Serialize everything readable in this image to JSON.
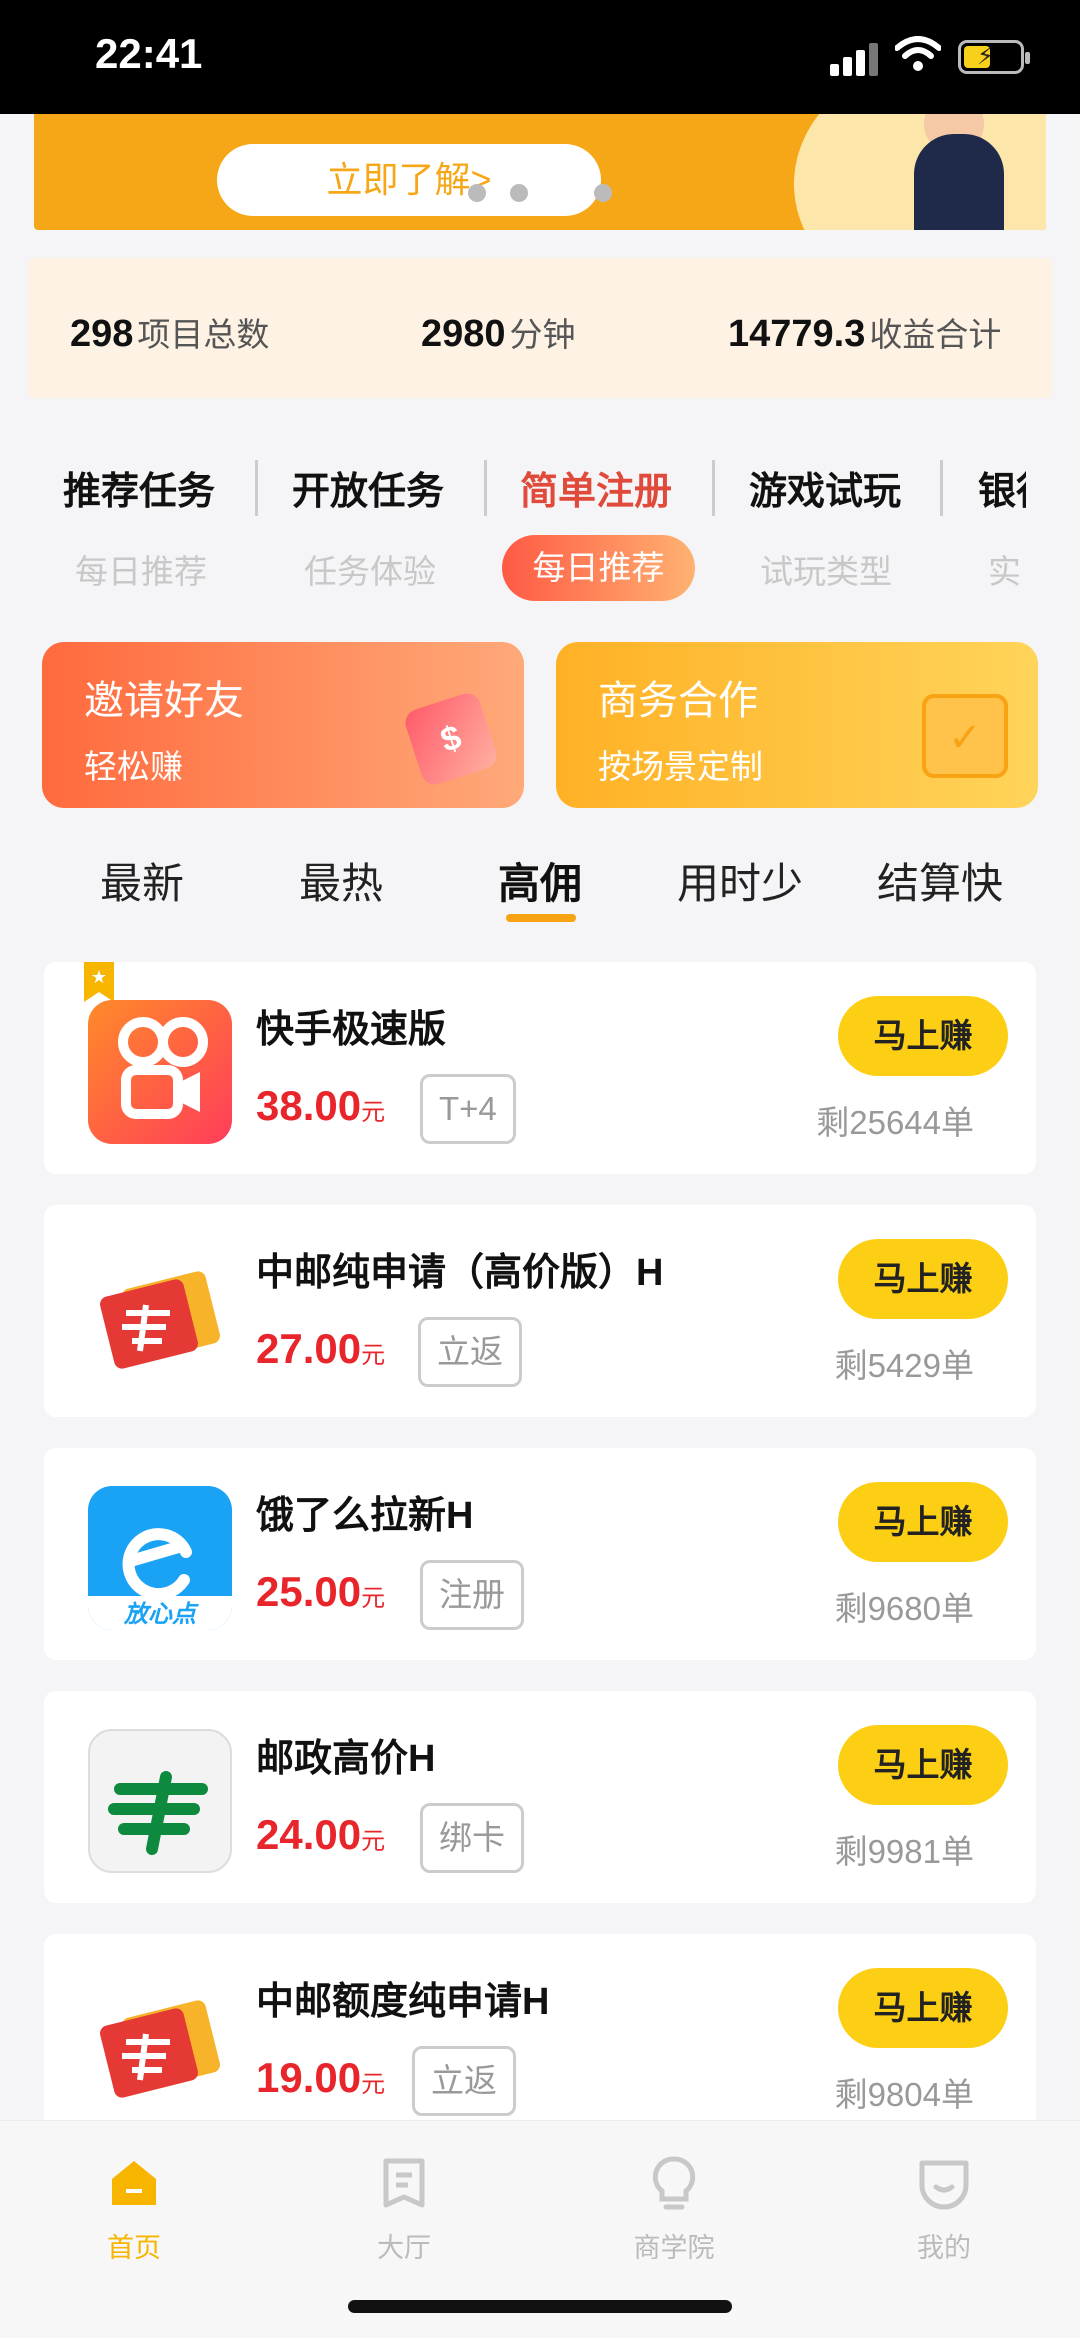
{
  "status_bar": {
    "time": "22:41"
  },
  "banner": {
    "button_label": "立即了解>"
  },
  "stats": [
    {
      "value": "298",
      "label": "项目总数"
    },
    {
      "value": "2980",
      "label": "分钟"
    },
    {
      "value": "14779.3",
      "label": "收益合计"
    }
  ],
  "categories": [
    "推荐任务",
    "开放任务",
    "简单注册",
    "游戏试玩",
    "银行"
  ],
  "subcategories": [
    "每日推荐",
    "任务体验",
    "每日推荐",
    "试玩类型",
    "实"
  ],
  "promos": {
    "left": {
      "title": "邀请好友",
      "subtitle": "轻松赚"
    },
    "right": {
      "title": "商务合作",
      "subtitle": "按场景定制"
    }
  },
  "sort_tabs": [
    "最新",
    "最热",
    "高佣",
    "用时少",
    "结算快"
  ],
  "tasks": [
    {
      "name": "快手极速版",
      "price": "38.00",
      "unit": "元",
      "tag": "T+4",
      "button": "马上赚",
      "remaining": "剩25644单"
    },
    {
      "name": "中邮纯申请（高价版）H",
      "price": "27.00",
      "unit": "元",
      "tag": "立返",
      "button": "马上赚",
      "remaining": "剩5429单"
    },
    {
      "name": "饿了么拉新H",
      "price": "25.00",
      "unit": "元",
      "tag": "注册",
      "button": "马上赚",
      "remaining": "剩9680单"
    },
    {
      "name": "邮政高价H",
      "price": "24.00",
      "unit": "元",
      "tag": "绑卡",
      "button": "马上赚",
      "remaining": "剩9981单"
    },
    {
      "name": "中邮额度纯申请H",
      "price": "19.00",
      "unit": "元",
      "tag": "立返",
      "button": "马上赚",
      "remaining": "剩9804单"
    }
  ],
  "icons": {
    "eleme_caption": "放心点"
  },
  "tab_bar": [
    {
      "label": "首页",
      "icon": "home-icon"
    },
    {
      "label": "大厅",
      "icon": "document-icon"
    },
    {
      "label": "商学院",
      "icon": "lightbulb-icon"
    },
    {
      "label": "我的",
      "icon": "face-icon"
    }
  ],
  "colors": {
    "accent": "#f7b500",
    "price": "#e8252a",
    "active_category": "#e04a3a"
  }
}
